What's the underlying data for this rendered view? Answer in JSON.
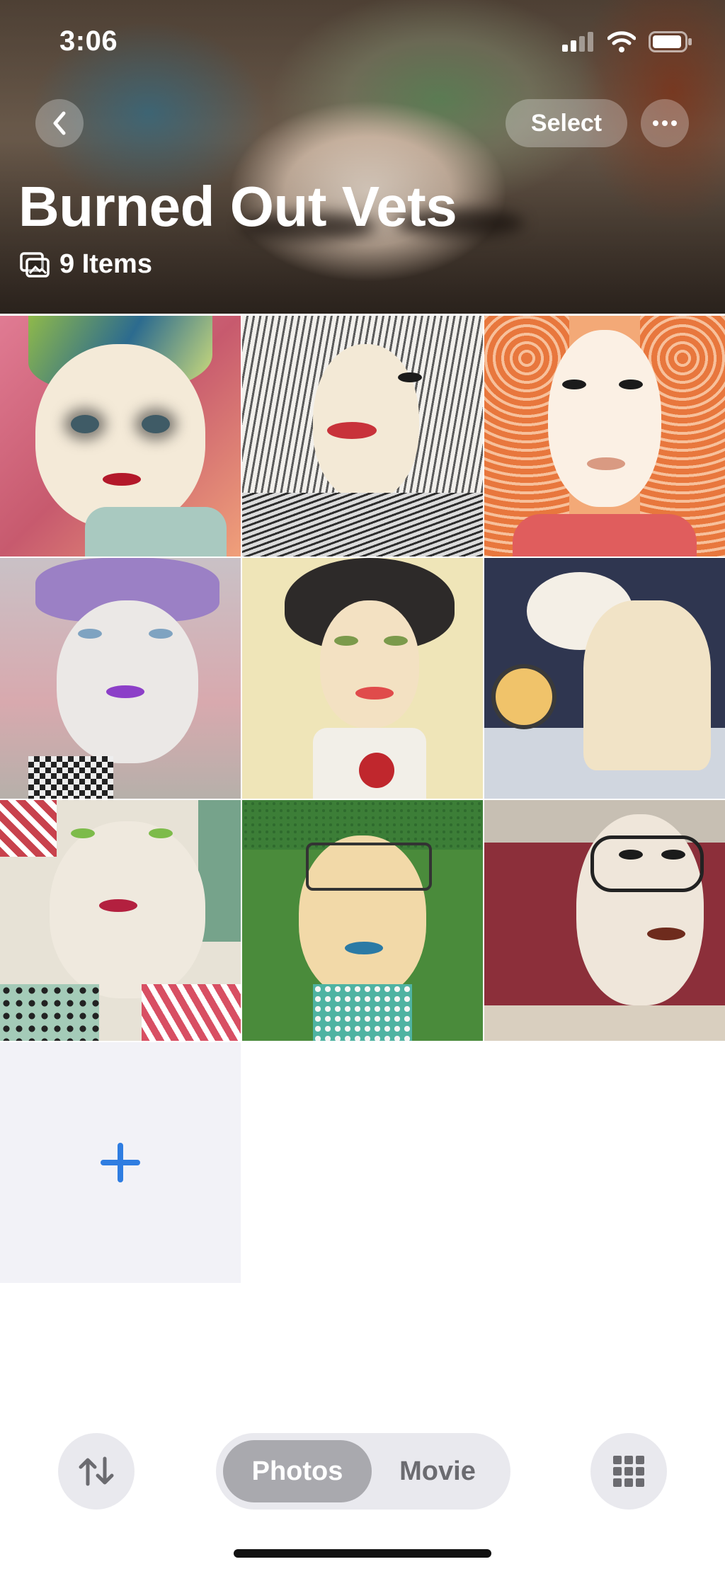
{
  "status_bar": {
    "time": "3:06",
    "icons": [
      "cellular-signal-icon",
      "wifi-icon",
      "battery-icon"
    ]
  },
  "nav": {
    "back_icon": "chevron-left-icon",
    "select_label": "Select",
    "more_icon": "ellipsis-icon"
  },
  "album": {
    "title": "Burned Out Vets",
    "count_label": "9 Items",
    "count_icon": "photo-stack-icon"
  },
  "grid": {
    "items": [
      {
        "label": "Portrait with green-streaked hair and smudged eyes",
        "palette": [
          "#d9778a",
          "#f4ead8",
          "#8fb94a"
        ]
      },
      {
        "label": "Portrait with grey striped hair and red lips",
        "palette": [
          "#f1eee6",
          "#6c6c6c",
          "#c8323a"
        ]
      },
      {
        "label": "Portrait with curly orange hair",
        "palette": [
          "#fbe8dc",
          "#e8773d",
          "#f3d9c2"
        ]
      },
      {
        "label": "Portrait with lavender hat and purple lips",
        "palette": [
          "#c9c1c6",
          "#9b80c5",
          "#e8e4e2"
        ]
      },
      {
        "label": "Portrait with dark bob and pearl necklace",
        "palette": [
          "#efe5b8",
          "#303030",
          "#f3e1c2"
        ]
      },
      {
        "label": "Figure bending over a table",
        "palette": [
          "#2f3650",
          "#f4efe6",
          "#f0c36a"
        ]
      },
      {
        "label": "Portrait with green eyes and polka dots",
        "palette": [
          "#e7e2d6",
          "#c8424d",
          "#76a38b"
        ]
      },
      {
        "label": "Portrait with green hat and glasses",
        "palette": [
          "#4a8b3b",
          "#f2d9a8",
          "#2b7aa5"
        ]
      },
      {
        "label": "Portrait with glasses on maroon background",
        "palette": [
          "#8c2f3a",
          "#efe6da",
          "#5a3a2a"
        ]
      }
    ],
    "add_icon": "plus-icon",
    "accent": "#2f7de1"
  },
  "toolbar": {
    "sort_icon": "sort-arrows-icon",
    "segments": [
      "Photos",
      "Movie"
    ],
    "selected_segment": "Photos",
    "grid_icon": "grid-icon"
  }
}
